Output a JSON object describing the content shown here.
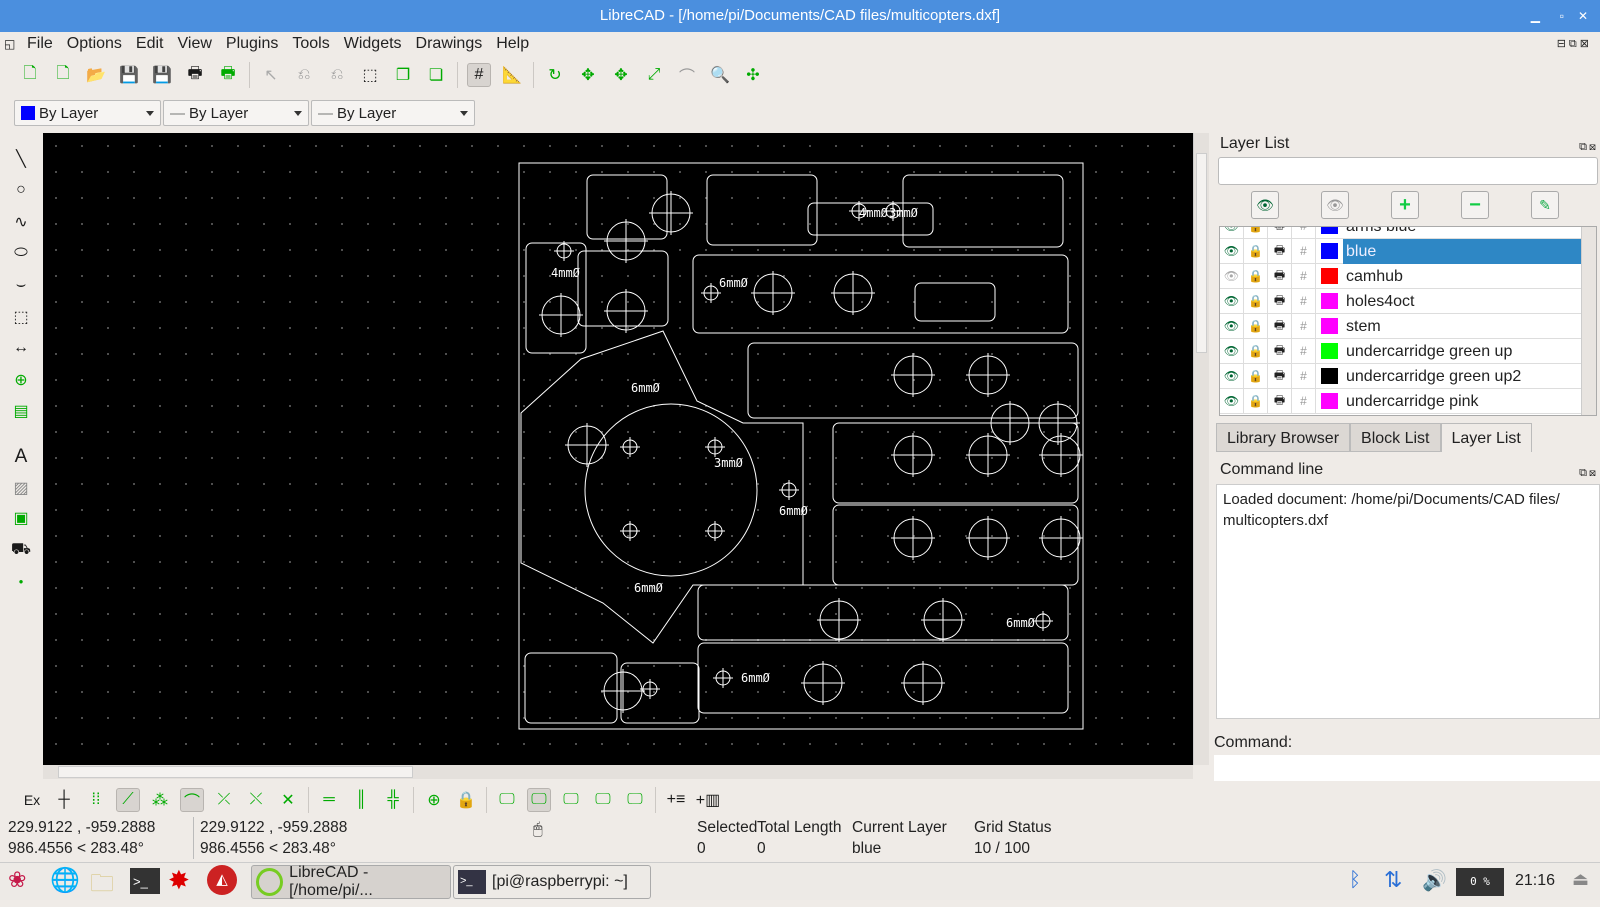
{
  "window": {
    "title": "LibreCAD - [/home/pi/Documents/CAD files/multicopters.dxf]",
    "min": "▁",
    "max": "▫",
    "close": "✕"
  },
  "menu": [
    "File",
    "Options",
    "Edit",
    "View",
    "Plugins",
    "Tools",
    "Widgets",
    "Drawings",
    "Help"
  ],
  "pen_toolbar": {
    "color": "By Layer",
    "linetype": "By Layer",
    "width": "By Layer",
    "color_swatch": "#0000ff"
  },
  "drawing_labels": [
    "4mmØ",
    "4mmØ",
    "3mmØ",
    "6mmØ",
    "6mmØ",
    "3mmØ",
    "6mmØ",
    "6mmØ",
    "6mmØ",
    "6mmØ"
  ],
  "layer_dock": {
    "title": "Layer List",
    "filter_value": "",
    "buttons": [
      "show-all",
      "hide-all",
      "add-layer",
      "remove-layer",
      "edit-layer"
    ],
    "layers": [
      {
        "name": "arms blue",
        "color": "#0000ff",
        "visible": true
      },
      {
        "name": "blue",
        "color": "#0000ff",
        "visible": true,
        "selected": true
      },
      {
        "name": "camhub",
        "color": "#ff0000",
        "visible": false
      },
      {
        "name": "holes4oct",
        "color": "#ff00ff",
        "visible": true
      },
      {
        "name": "stem",
        "color": "#ff00ff",
        "visible": true
      },
      {
        "name": "undercarridge green up",
        "color": "#00ff00",
        "visible": true
      },
      {
        "name": "undercarridge green up2",
        "color": "#000000",
        "visible": true
      },
      {
        "name": "undercarridge pink",
        "color": "#ff00ff",
        "visible": true
      }
    ],
    "tabs": [
      "Library Browser",
      "Block List",
      "Layer List"
    ],
    "active_tab": "Layer List"
  },
  "command_dock": {
    "title": "Command line",
    "output": "Loaded document: /home/pi/Documents/CAD files/ multicopters.dxf",
    "prompt": "Command:",
    "input": ""
  },
  "snap": {
    "ex": "Ex"
  },
  "status": {
    "abs_coord": "229.9122 , -959.2888",
    "abs_polar": "986.4556 < 283.48°",
    "rel_coord": "229.9122 , -959.2888",
    "rel_polar": "986.4556 < 283.48°",
    "selected_label": "Selected",
    "selected": "0",
    "total_length_label": "Total Length",
    "total_length": "0",
    "current_layer_label": "Current Layer",
    "current_layer": "blue",
    "grid_status_label": "Grid Status",
    "grid_status": "10 / 100"
  },
  "taskbar": {
    "tasks": [
      "LibreCAD - [/home/pi/...",
      "[pi@raspberrypi: ~]"
    ],
    "cpu": "0 %",
    "clock": "21:16"
  }
}
